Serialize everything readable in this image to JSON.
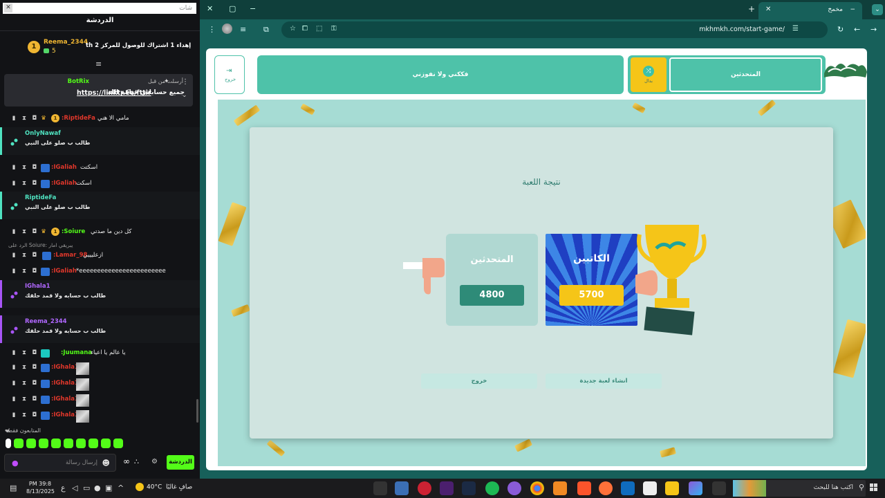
{
  "chat": {
    "search_placeholder": "شات",
    "title": "الدردشة",
    "gift": {
      "rank": "1",
      "username": "Reema_2344",
      "count": "5",
      "text": "th إهداء 1 اشتراك للوصول للمركز 2"
    },
    "pinned": {
      "by": "أرسلت من قبل",
      "bot": "BotRix",
      "message": "جميع حساباتي حياكم الله",
      "link": "https://linktr.ee/fttir"
    },
    "rows": [
      {
        "user": ":RiptideFa",
        "text": "مامي الا هني",
        "rank": "1"
      },
      {
        "user": ":IGaliah",
        "text": "اسكتت"
      },
      {
        "user": ":IGaliah",
        "text": "اسكت"
      },
      {
        "user": ":Soiure",
        "text": "كل دين ما صدتي",
        "rank": "1"
      },
      {
        "user": ":Lamar_98",
        "text": "ازعليييي"
      },
      {
        "user": ":IGaliah",
        "text": "*eeeeeeeeeeeeeeeeeeeeeeee"
      },
      {
        "user": ":Juumana",
        "text": "يا عالم يا اعياء"
      },
      {
        "user": ":IGhala1",
        "text": ""
      },
      {
        "user": ":IGhala1",
        "text": ""
      },
      {
        "user": ":IGhala1",
        "text": ""
      },
      {
        "user": ":IGhala1",
        "text": ""
      }
    ],
    "reply_line": "الرد على Soiure: يبريقي امار",
    "cards": [
      {
        "user": "OnlyNawaf",
        "text": "طالب ب صلو على النبي"
      },
      {
        "user": "RiptideFa",
        "text": "طالب ب صلو على النبي"
      },
      {
        "user": "IGhala1",
        "text": "طالب ب حسابه ولا قمد حلقك"
      },
      {
        "user": "Reema_2344",
        "text": "طالب ب حسابه ولا قمد حلقك"
      }
    ],
    "followers_only": "المتابعون فقط",
    "input_placeholder": "إرسال رسالة",
    "send_label": "الدردشة"
  },
  "browser": {
    "tab_title": "مخمخ",
    "url": "mkhmkh.com/start-game/"
  },
  "game": {
    "team1_label": "المتحدثين",
    "team2_label": "فككني ولا نفوزني",
    "swap_label": "بدال",
    "exit_top_label": "خروج",
    "result_title": "نتيجة اللعبة",
    "team_loser": {
      "name": "المتحدثين",
      "score": "4800"
    },
    "team_winner": {
      "name": "الكاتبين",
      "score": "5700"
    },
    "new_game_label": "انشاء لعبة جديدة",
    "exit_label": "خروج"
  },
  "taskbar": {
    "search_placeholder": "اكتب هنا للبحث",
    "weather_temp": "40°C",
    "weather_text": "صافٍ غالبًا",
    "time": "PM 39:8",
    "date": "8/13/2025",
    "lang": "ع"
  },
  "colors": {
    "kick_green": "#53fc18",
    "teal": "#4ec2a9",
    "gold": "#f5c518",
    "score_green": "#2e8b78"
  }
}
